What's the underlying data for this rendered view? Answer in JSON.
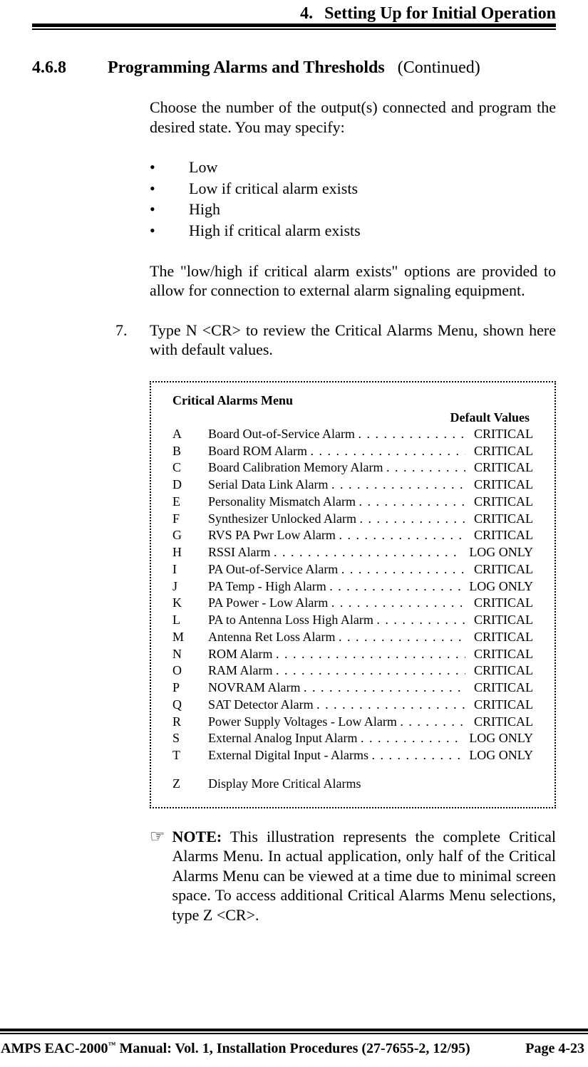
{
  "header": {
    "chapter_number": "4.",
    "chapter_title": "Setting Up for Initial Operation"
  },
  "section": {
    "number": "4.6.8",
    "title": "Programming Alarms and Thresholds",
    "continued": "(Continued)"
  },
  "intro": "Choose the number of the output(s) connected and program the desired state.  You may specify:",
  "bullets": [
    "Low",
    "Low if critical alarm exists",
    "High",
    "High if critical alarm exists"
  ],
  "para2": "The \"low/high if critical alarm exists\" options are provided to allow for connection to external alarm signaling equipment.",
  "step": {
    "number": "7.",
    "pre": "Type ",
    "cmd": "N <CR>",
    "post": " to review the Critical Alarms Menu, shown here with default values."
  },
  "menu": {
    "title": "Critical Alarms Menu",
    "default_values_label": "Default Values",
    "items": [
      {
        "letter": "A",
        "label": "Board Out-of-Service Alarm",
        "value": "CRITICAL"
      },
      {
        "letter": "B",
        "label": "Board ROM Alarm",
        "value": "CRITICAL"
      },
      {
        "letter": "C",
        "label": "Board Calibration Memory Alarm",
        "value": "CRITICAL"
      },
      {
        "letter": "D",
        "label": "Serial Data Link Alarm",
        "value": "CRITICAL"
      },
      {
        "letter": "E",
        "label": "Personality Mismatch Alarm",
        "value": "CRITICAL"
      },
      {
        "letter": "F",
        "label": "Synthesizer Unlocked Alarm",
        "value": "CRITICAL"
      },
      {
        "letter": "G",
        "label": "RVS PA Pwr Low Alarm",
        "value": "CRITICAL"
      },
      {
        "letter": "H",
        "label": "RSSI Alarm",
        "value": "LOG ONLY"
      },
      {
        "letter": "I",
        "label": "PA Out-of-Service Alarm",
        "value": "CRITICAL"
      },
      {
        "letter": "J",
        "label": "PA Temp - High Alarm",
        "value": "LOG ONLY"
      },
      {
        "letter": "K",
        "label": "PA Power - Low Alarm",
        "value": "CRITICAL"
      },
      {
        "letter": "L",
        "label": "PA to Antenna Loss High Alarm",
        "value": "CRITICAL"
      },
      {
        "letter": "M",
        "label": "Antenna Ret Loss Alarm",
        "value": "CRITICAL"
      },
      {
        "letter": "N",
        "label": "ROM Alarm",
        "value": "CRITICAL"
      },
      {
        "letter": "O",
        "label": "RAM Alarm",
        "value": "CRITICAL"
      },
      {
        "letter": "P",
        "label": "NOVRAM Alarm",
        "value": "CRITICAL"
      },
      {
        "letter": "Q",
        "label": "SAT Detector Alarm",
        "value": "CRITICAL"
      },
      {
        "letter": "R",
        "label": "Power Supply Voltages - Low Alarm",
        "value": "CRITICAL"
      },
      {
        "letter": "S",
        "label": "External Analog Input Alarm",
        "value": "LOG ONLY"
      },
      {
        "letter": "T",
        "label": "External Digital Input - Alarms",
        "value": "LOG ONLY"
      }
    ],
    "more": {
      "letter": "Z",
      "label": "Display More Critical Alarms"
    }
  },
  "note": {
    "label": "NOTE:",
    "text_a": "  This illustration represents the complete Critical Alarms Menu.   In actual application, only half of the Critical Alarms Menu can be viewed at a time due to minimal screen space.   To access additional Critical Alarms Menu selections, type ",
    "cmd": "Z <CR>",
    "text_b": "."
  },
  "footer": {
    "left_a": "AMPS EAC-2000",
    "tm": "™",
    "left_b": " Manual:  Vol. 1, Installation Procedures (27-7655-2, 12/95)",
    "right": "Page 4-23"
  }
}
